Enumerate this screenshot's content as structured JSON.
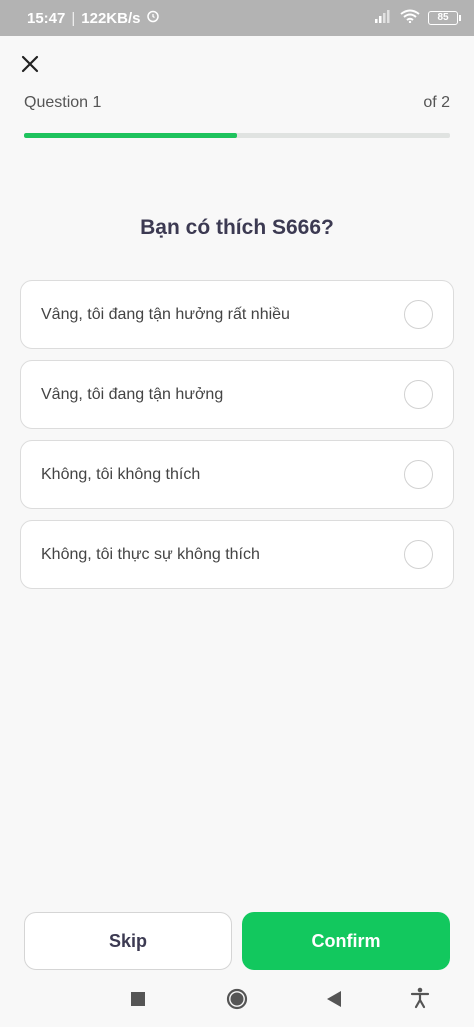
{
  "status_bar": {
    "time": "15:47",
    "network_speed": "122KB/s",
    "alarm_icon": "alarm-clock-icon",
    "signal_icon": "signal-bars-icon",
    "wifi_icon": "wifi-icon",
    "battery_level": "85"
  },
  "header": {
    "close_icon": "close-icon",
    "question_counter": "Question 1",
    "total_counter": "of 2",
    "progress_fraction": 0.5
  },
  "question": {
    "text": "Bạn có thích S666?"
  },
  "options": [
    {
      "label": "Vâng, tôi đang tận hưởng rất nhiều",
      "selected": false
    },
    {
      "label": "Vâng, tôi đang tận hưởng",
      "selected": false
    },
    {
      "label": "Không, tôi không thích",
      "selected": false
    },
    {
      "label": "Không, tôi thực sự không thích",
      "selected": false
    }
  ],
  "actions": {
    "skip_label": "Skip",
    "confirm_label": "Confirm"
  },
  "nav_bar": {
    "recents_icon": "square-recents-icon",
    "home_icon": "circle-home-icon",
    "back_icon": "triangle-back-icon",
    "accessibility_icon": "accessibility-icon"
  },
  "colors": {
    "accent": "#12c85e",
    "progress": "#1ec35d",
    "text_dark": "#3c3a52",
    "status_bar_bg": "#b3b3b3"
  }
}
